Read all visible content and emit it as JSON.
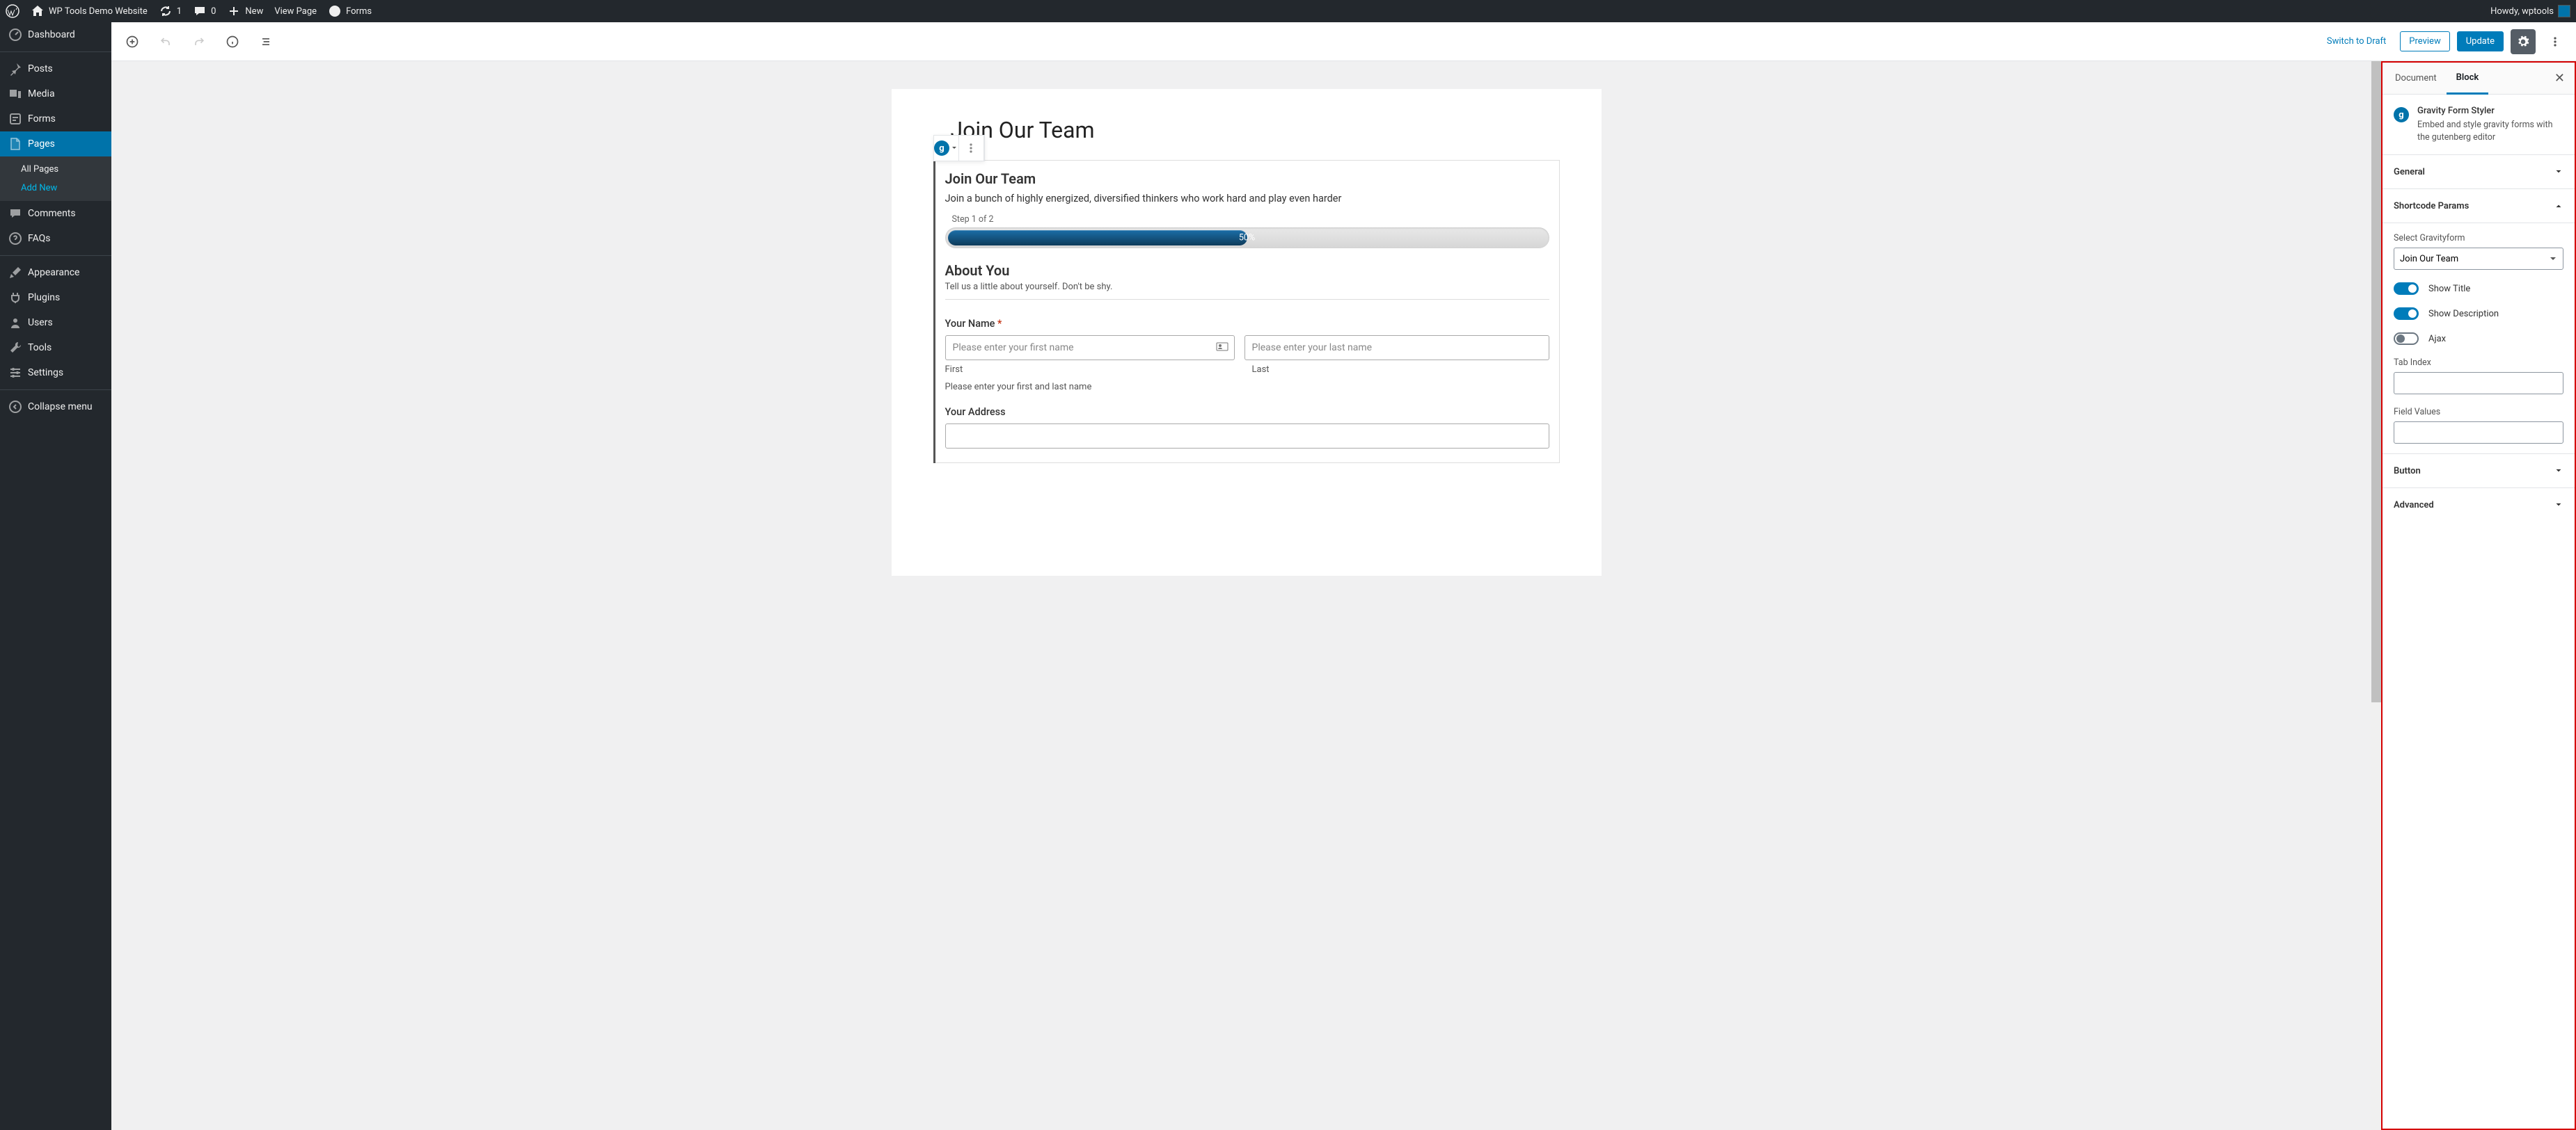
{
  "adminbar": {
    "site_name": "WP Tools Demo Website",
    "refresh_count": "1",
    "comment_count": "0",
    "new_label": "New",
    "view_page": "View Page",
    "forms": "Forms",
    "howdy": "Howdy, wptools"
  },
  "sidebar": {
    "items": [
      {
        "label": "Dashboard",
        "icon": "dashboard"
      },
      {
        "label": "Posts",
        "icon": "pin"
      },
      {
        "label": "Media",
        "icon": "media"
      },
      {
        "label": "Forms",
        "icon": "forms"
      },
      {
        "label": "Pages",
        "icon": "page",
        "active": true
      },
      {
        "label": "Comments",
        "icon": "comment"
      },
      {
        "label": "FAQs",
        "icon": "help"
      },
      {
        "label": "Appearance",
        "icon": "brush"
      },
      {
        "label": "Plugins",
        "icon": "plug"
      },
      {
        "label": "Users",
        "icon": "user"
      },
      {
        "label": "Tools",
        "icon": "wrench"
      },
      {
        "label": "Settings",
        "icon": "sliders"
      },
      {
        "label": "Collapse menu",
        "icon": "collapse"
      }
    ],
    "submenu": {
      "all_pages": "All Pages",
      "add_new": "Add New"
    }
  },
  "topbar": {
    "switch_draft": "Switch to Draft",
    "preview": "Preview",
    "update": "Update"
  },
  "page": {
    "title": "Join Our Team"
  },
  "form": {
    "title": "Join Our Team",
    "description": "Join a bunch of highly energized, diversified thinkers who work hard and play even harder",
    "step_label": "Step 1 of 2",
    "progress_pct": "50%",
    "section_title": "About You",
    "section_sub": "Tell us a little about yourself. Don't be shy.",
    "name_label": "Your Name",
    "required_mark": "*",
    "first_placeholder": "Please enter your first name",
    "last_placeholder": "Please enter your last name",
    "first_sub": "First",
    "last_sub": "Last",
    "name_hint": "Please enter your first and last name",
    "address_label": "Your Address"
  },
  "inspector": {
    "tab_document": "Document",
    "tab_block": "Block",
    "block_name": "Gravity Form Styler",
    "block_desc": "Embed and style gravity forms with the gutenberg editor",
    "panel_general": "General",
    "panel_shortcode": "Shortcode Params",
    "panel_button": "Button",
    "panel_advanced": "Advanced",
    "select_label": "Select Gravityform",
    "select_value": "Join Our Team",
    "show_title": "Show Title",
    "show_description": "Show Description",
    "ajax": "Ajax",
    "tab_index": "Tab Index",
    "field_values": "Field Values"
  }
}
